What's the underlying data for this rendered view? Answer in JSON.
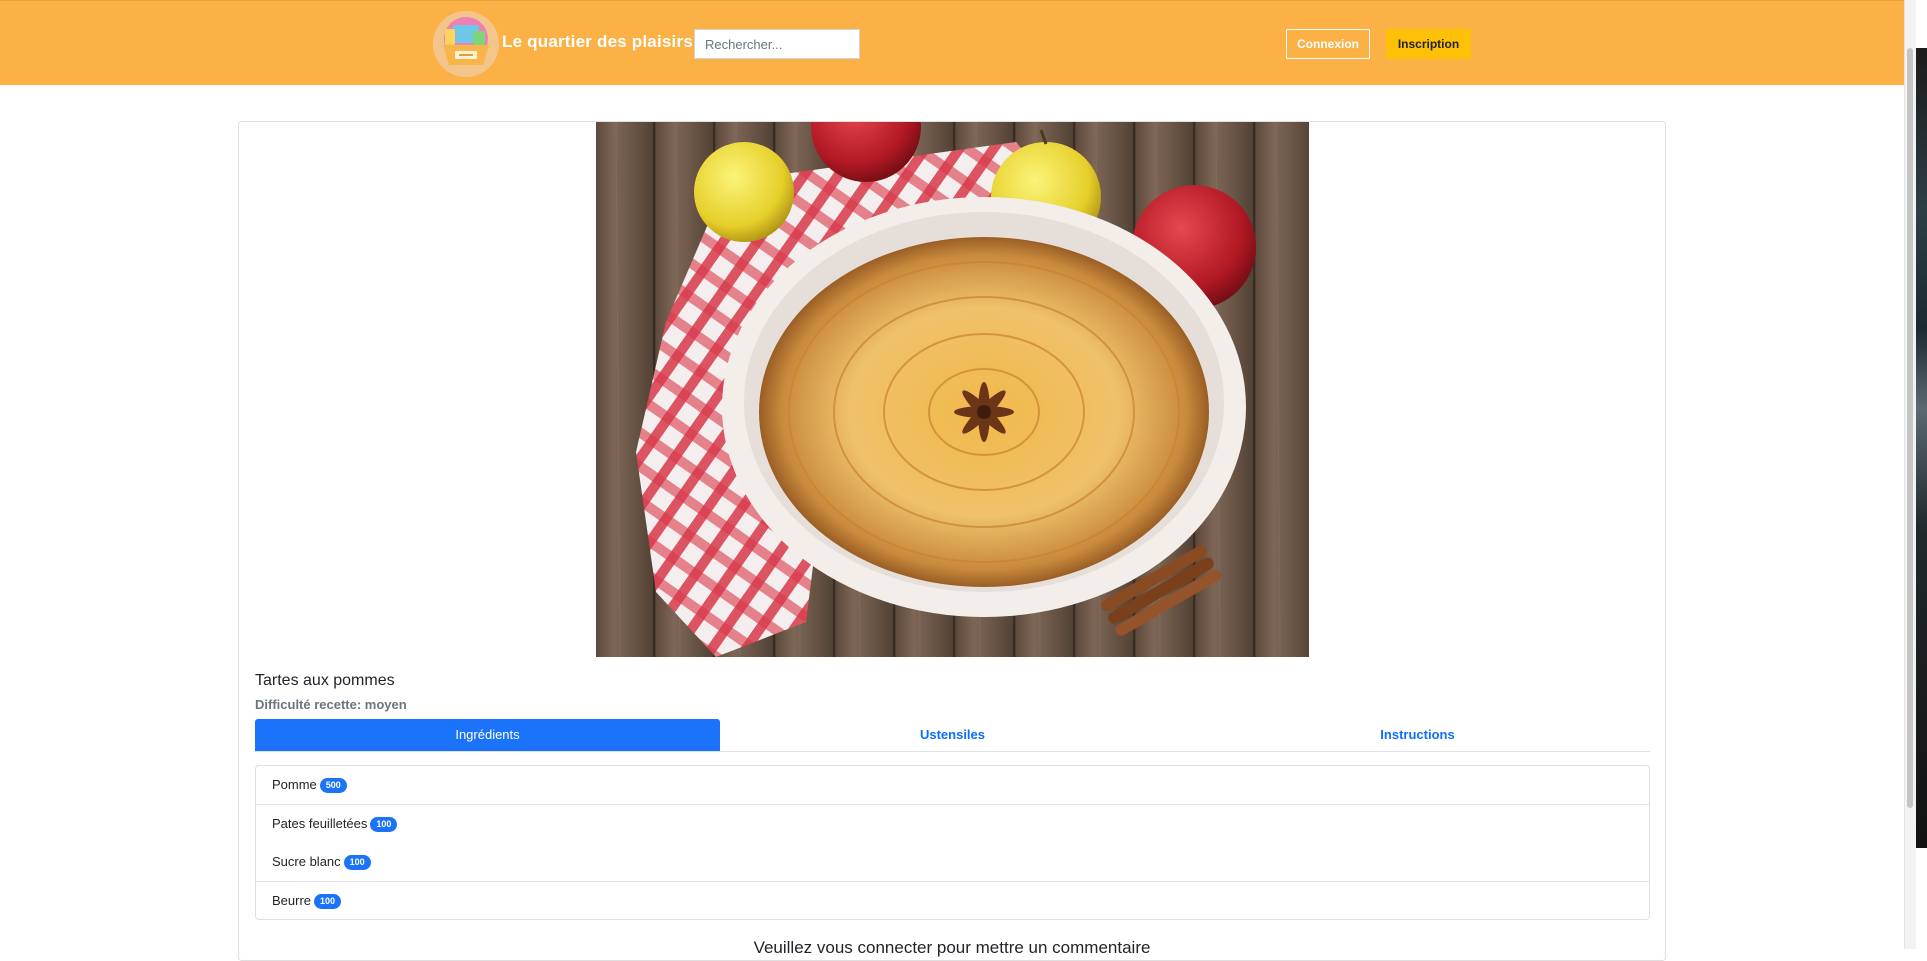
{
  "header": {
    "brand": "Le quartier des plaisirs",
    "search_placeholder": "Rechercher...",
    "login_label": "Connexion",
    "signup_label": "Inscription",
    "background_color": "#fbb145"
  },
  "recipe": {
    "title": "Tartes aux pommes",
    "difficulty": "Difficulté recette: moyen",
    "tabs": [
      {
        "label": "Ingrédients",
        "active": true
      },
      {
        "label": "Ustensiles",
        "active": false
      },
      {
        "label": "Instructions",
        "active": false
      }
    ],
    "ingredients": [
      {
        "name": "Pomme",
        "qty": "500"
      },
      {
        "name": "Pates feuilletées",
        "qty": "100"
      },
      {
        "name": "Sucre blanc",
        "qty": "100"
      },
      {
        "name": "Beurre",
        "qty": "100"
      }
    ],
    "comment_note": "Veuillez vous connecter pour mettre un commentaire"
  },
  "colors": {
    "accent_blue": "#1a73f8",
    "signup_yellow": "#ffc107"
  }
}
